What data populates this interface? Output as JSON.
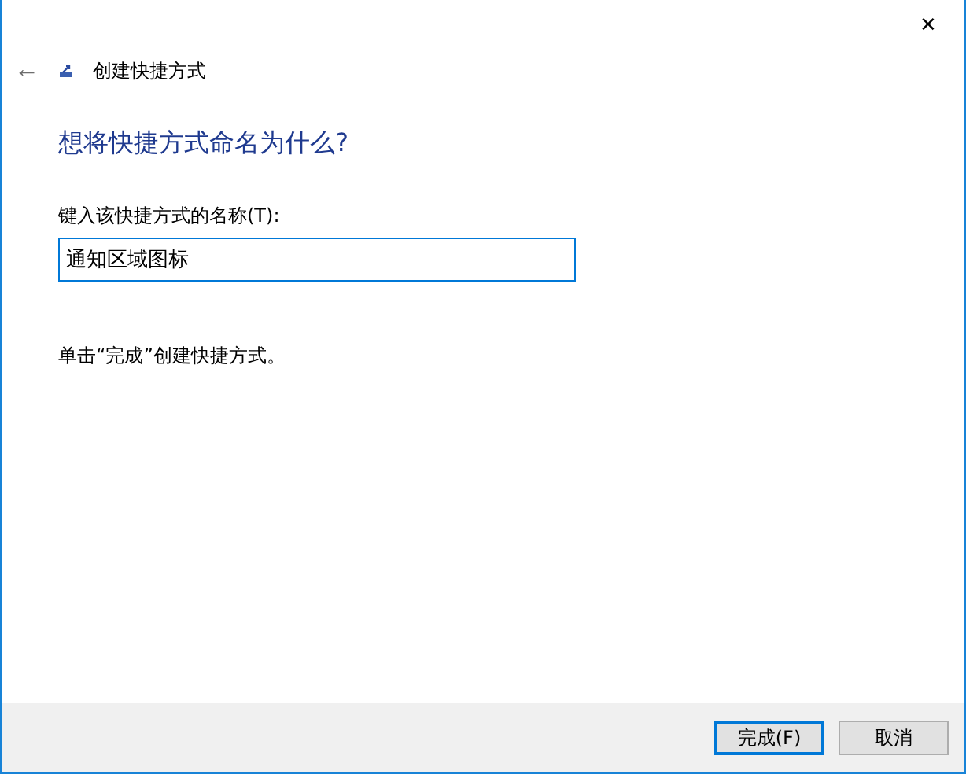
{
  "window": {
    "close": "✕"
  },
  "header": {
    "back": "←",
    "title": "创建快捷方式"
  },
  "heading": "想将快捷方式命名为什么?",
  "name_field": {
    "label": "键入该快捷方式的名称(T):",
    "value": "通知区域图标",
    "focused": true
  },
  "instruction": "单击“完成”创建快捷方式。",
  "buttons": [
    {
      "label": "完成(F)",
      "default": true
    },
    {
      "label": "取消",
      "default": false
    }
  ]
}
